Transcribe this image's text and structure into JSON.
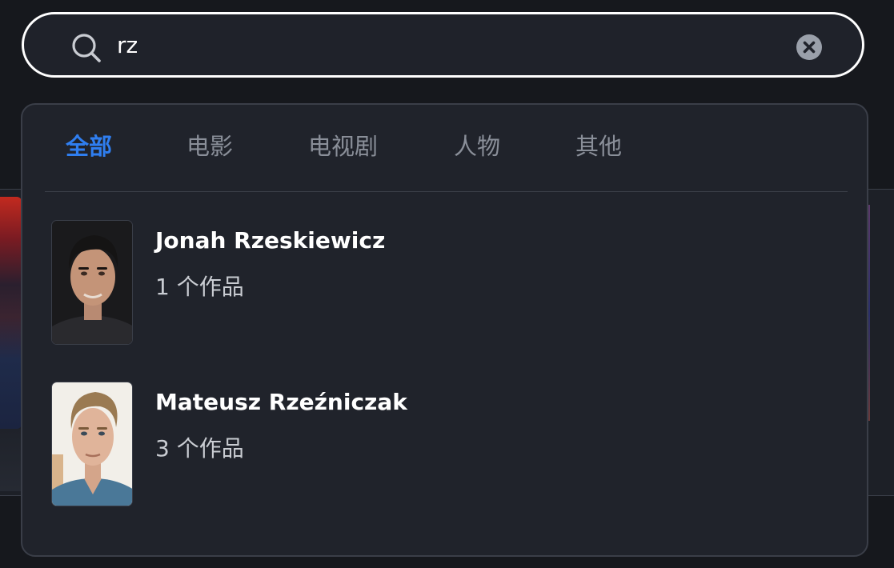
{
  "search": {
    "value": "rz",
    "icon": "search-icon",
    "clear_icon": "close-circle-icon"
  },
  "tabs": [
    {
      "label": "全部",
      "active": true
    },
    {
      "label": "电影",
      "active": false
    },
    {
      "label": "电视剧",
      "active": false
    },
    {
      "label": "人物",
      "active": false
    },
    {
      "label": "其他",
      "active": false
    }
  ],
  "results": [
    {
      "name": "Jonah Rzeskiewicz",
      "works": "1 个作品"
    },
    {
      "name": "Mateusz Rzeźniczak",
      "works": "3 个作品"
    }
  ],
  "colors": {
    "accent": "#2f7ef0",
    "panel": "#20232b",
    "background": "#16181d"
  }
}
